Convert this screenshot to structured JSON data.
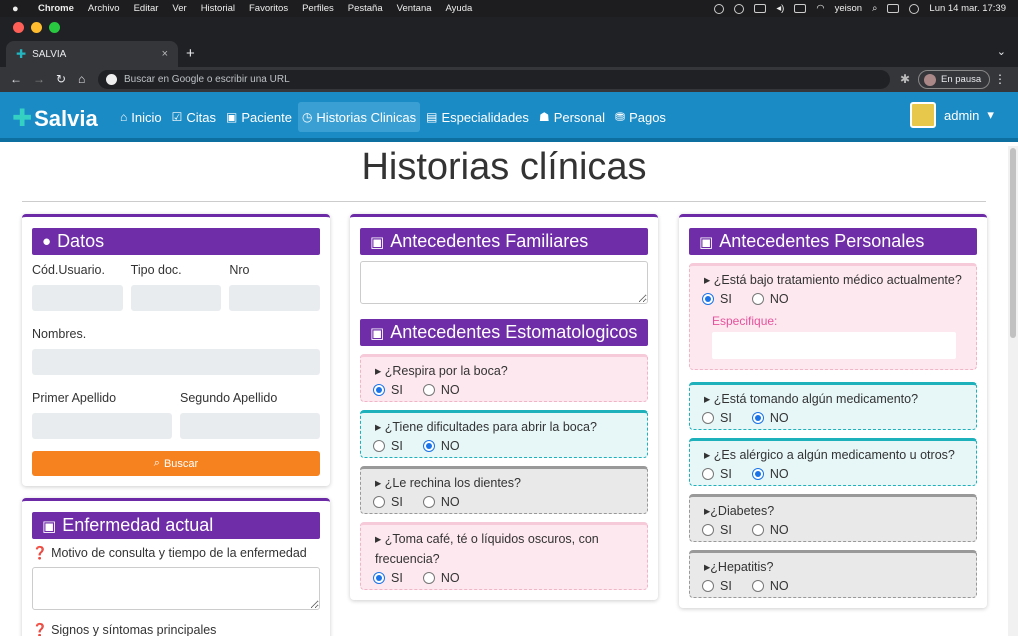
{
  "mac": {
    "menus": [
      "Chrome",
      "Archivo",
      "Editar",
      "Ver",
      "Historial",
      "Favoritos",
      "Perfiles",
      "Pestaña",
      "Ventana",
      "Ayuda"
    ],
    "user": "yeison",
    "datetime": "Lun 14 mar.  17:39"
  },
  "browser": {
    "tab_title": "SALVIA",
    "tab_close": "×",
    "new_tab": "+",
    "address_placeholder": "Buscar en Google o escribir una URL",
    "profile_status": "En pausa"
  },
  "navbar": {
    "brand": "Salvia",
    "items": [
      "Inicio",
      "Citas",
      "Paciente",
      "Historias Clinicas",
      "Especialidades",
      "Personal",
      "Pagos"
    ],
    "user": "admin"
  },
  "page_title": "Historias clínicas",
  "datos": {
    "title": "Datos",
    "cod_usuario": "Cód.Usuario.",
    "tipo_doc": "Tipo doc.",
    "nro": "Nro",
    "nombres": "Nombres.",
    "primer_apellido": "Primer Apellido",
    "segundo_apellido": "Segundo Apellido",
    "buscar": "Buscar"
  },
  "enfermedad": {
    "title": "Enfermedad actual",
    "motivo": "Motivo de consulta y tiempo de la enfermedad",
    "signos": "Signos y síntomas principales"
  },
  "familiares": {
    "title": "Antecedentes Familiares"
  },
  "estomatologicos": {
    "title": "Antecedentes Estomatologicos",
    "questions": [
      {
        "text": "¿Respira por la boca?",
        "selected": "SI"
      },
      {
        "text": "¿Tiene dificultades para abrir la boca?",
        "selected": "NO"
      },
      {
        "text": "¿Le rechina los dientes?",
        "selected": ""
      },
      {
        "text": "¿Toma café, té o líquidos oscuros, con frecuencia?",
        "selected": "SI"
      }
    ]
  },
  "personales": {
    "title": "Antecedentes Personales",
    "especifique": "Especifique:",
    "questions": [
      {
        "text": "¿Está bajo tratamiento médico actualmente?",
        "selected": "SI"
      },
      {
        "text": "¿Está tomando algún medicamento?",
        "selected": "NO"
      },
      {
        "text": "¿Es alérgico a algún medicamento u otros?",
        "selected": "NO"
      },
      {
        "text": "¿Diabetes?",
        "selected": ""
      },
      {
        "text": "¿Hepatitis?",
        "selected": ""
      }
    ]
  },
  "options": {
    "si": "SI",
    "no": "NO"
  },
  "colors": {
    "navbar": "#1b8bc6",
    "card_header": "#6f2da8",
    "buscar": "#f6821f",
    "accent_teal": "#1eb0bb"
  }
}
